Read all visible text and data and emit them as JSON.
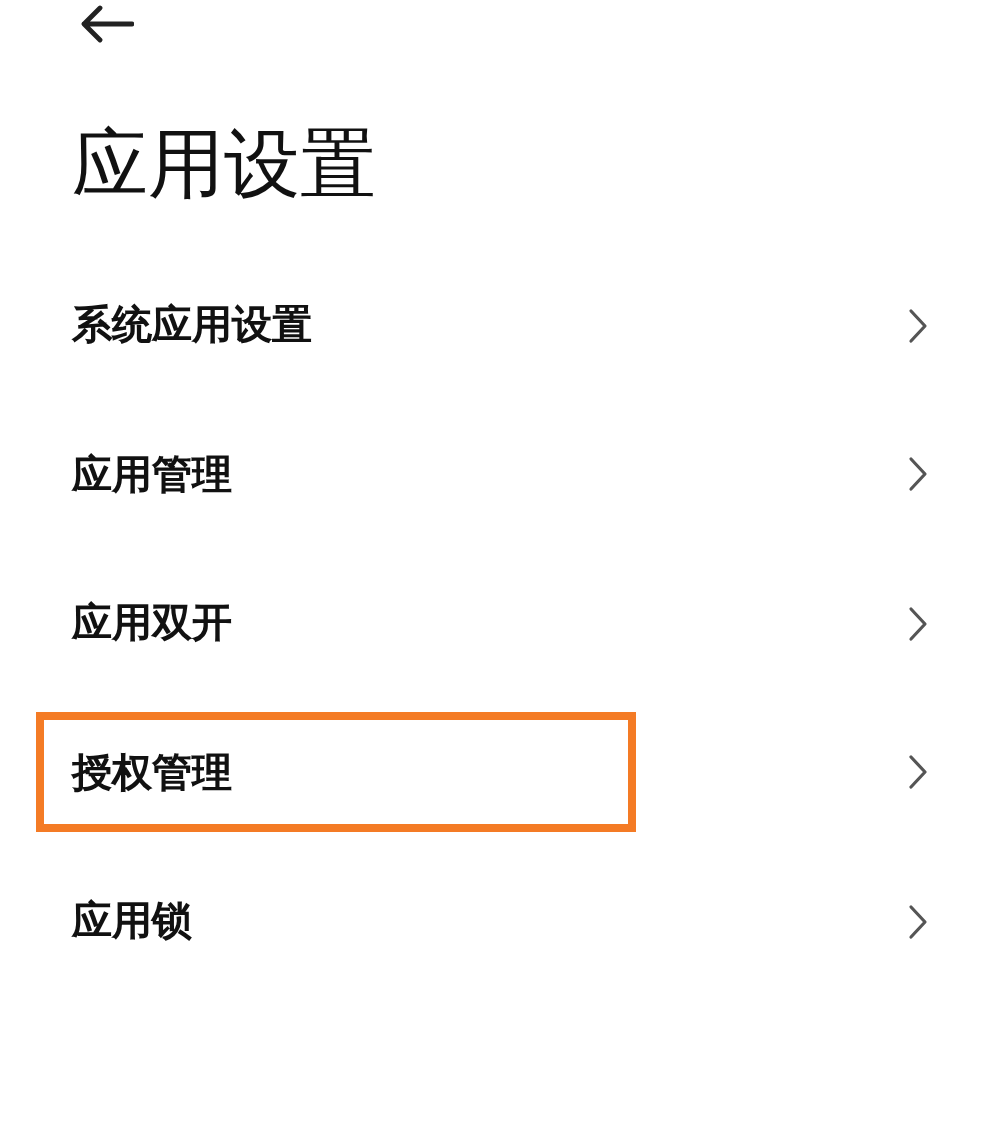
{
  "title": "应用设置",
  "items": [
    {
      "label": "系统应用设置",
      "highlighted": false
    },
    {
      "label": "应用管理",
      "highlighted": false
    },
    {
      "label": "应用双开",
      "highlighted": false
    },
    {
      "label": "授权管理",
      "highlighted": true
    },
    {
      "label": "应用锁",
      "highlighted": false
    }
  ]
}
